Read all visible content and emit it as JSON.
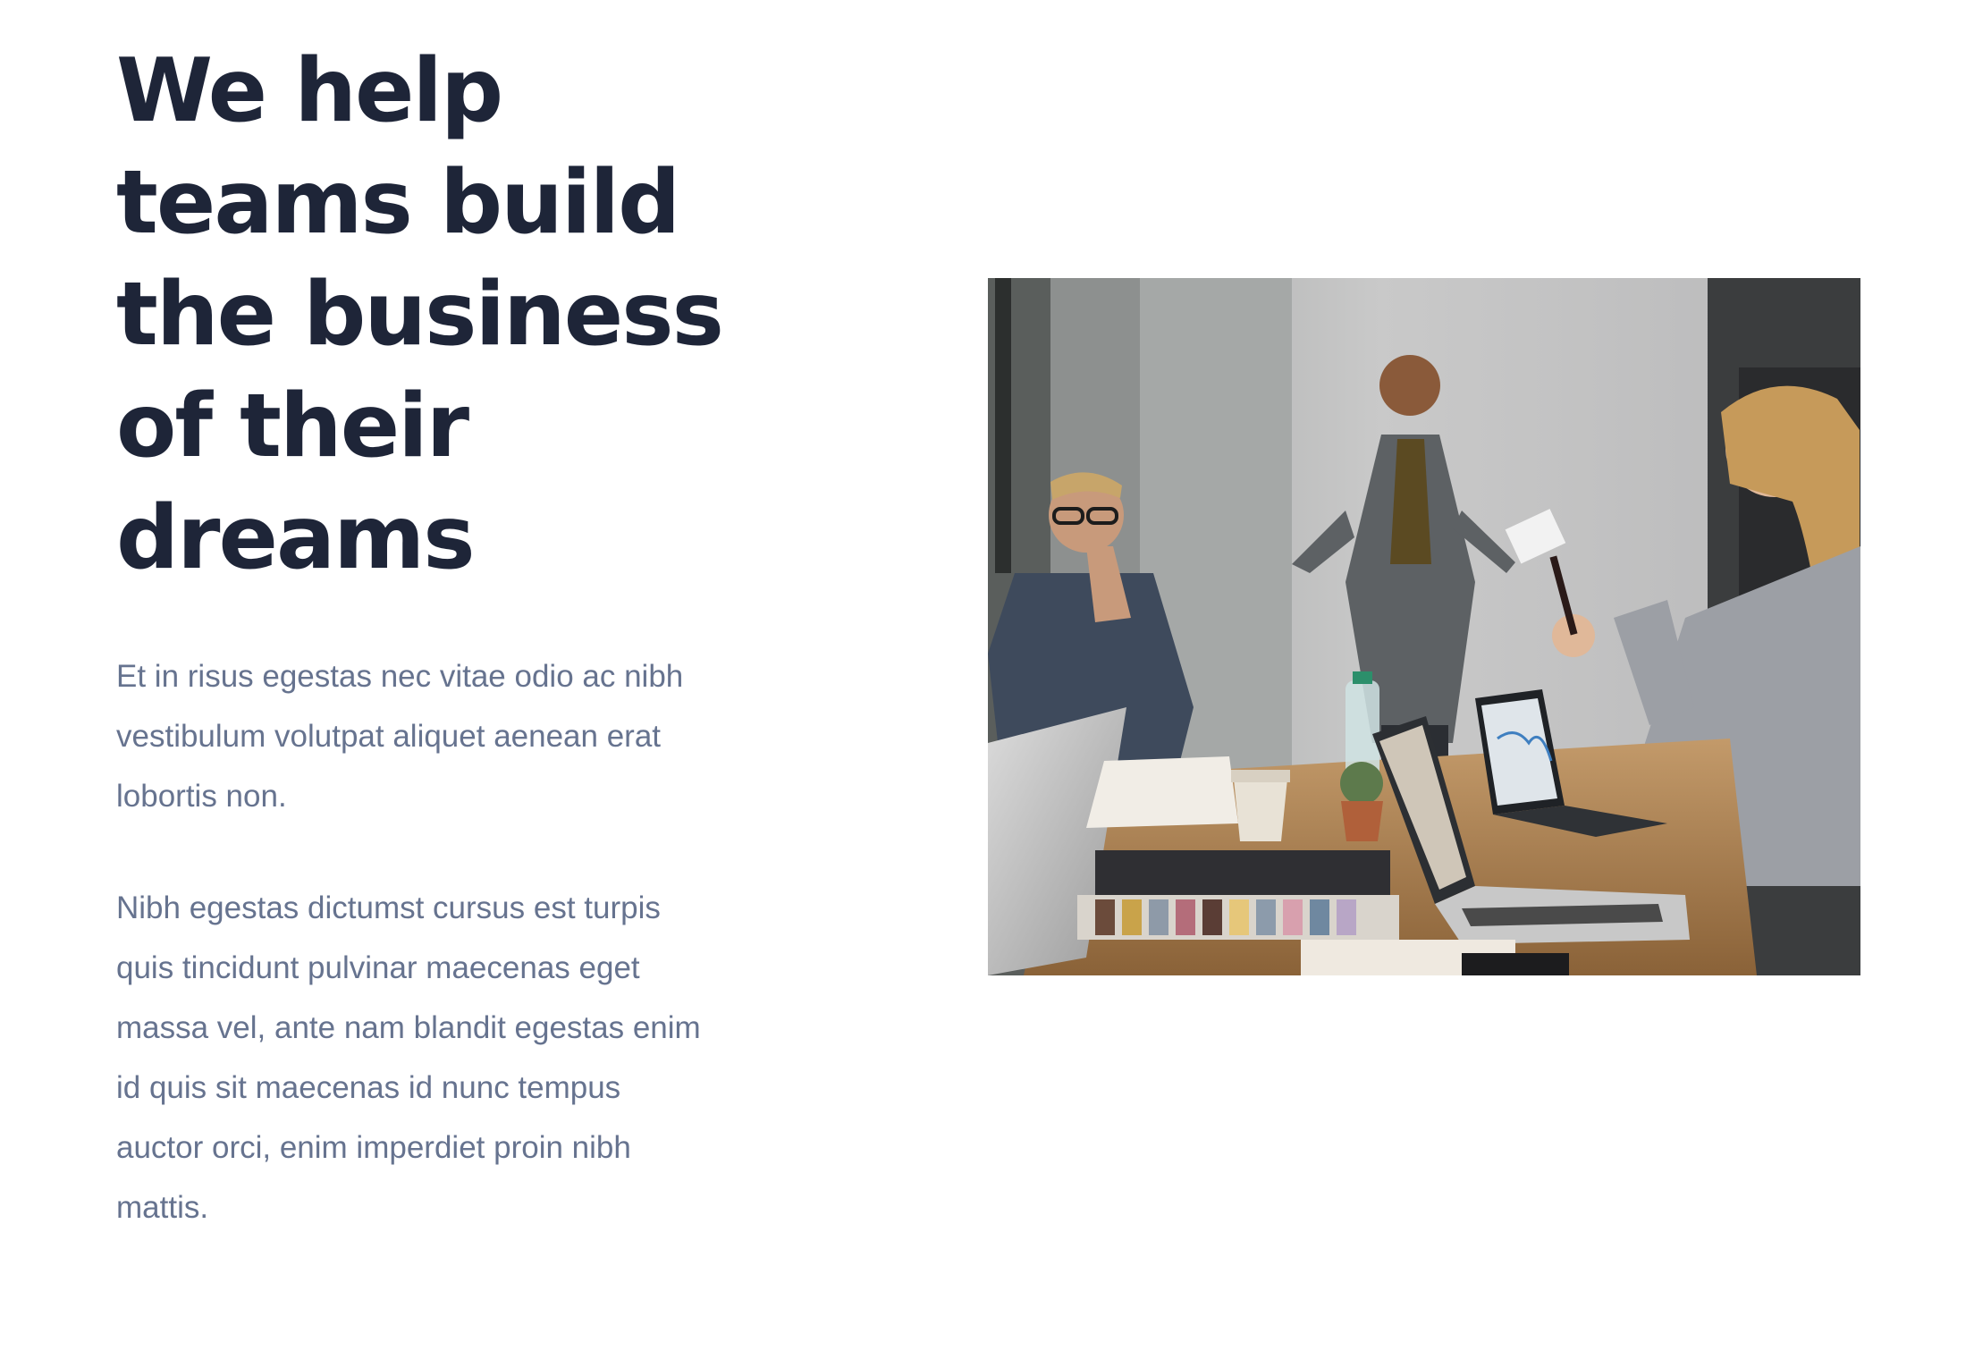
{
  "headline": {
    "lines": [
      "We help",
      "teams build",
      "the business",
      "of their",
      "dreams"
    ]
  },
  "paragraph1": {
    "lines": [
      "Et in risus egestas nec vitae odio ac nibh",
      "vestibulum volutpat aliquet aenean erat",
      "lobortis non."
    ]
  },
  "paragraph2": {
    "lines": [
      "Nibh egestas dictumst cursus est turpis",
      "quis tincidunt pulvinar maecenas eget",
      "massa vel, ante nam blandit egestas enim",
      "id quis sit maecenas id nunc tempus",
      "auctor orci, enim imperdiet proin nibh",
      "mattis."
    ]
  },
  "colors": {
    "heading": "#1e2538",
    "body_text": "#66738f",
    "background": "#ffffff"
  }
}
